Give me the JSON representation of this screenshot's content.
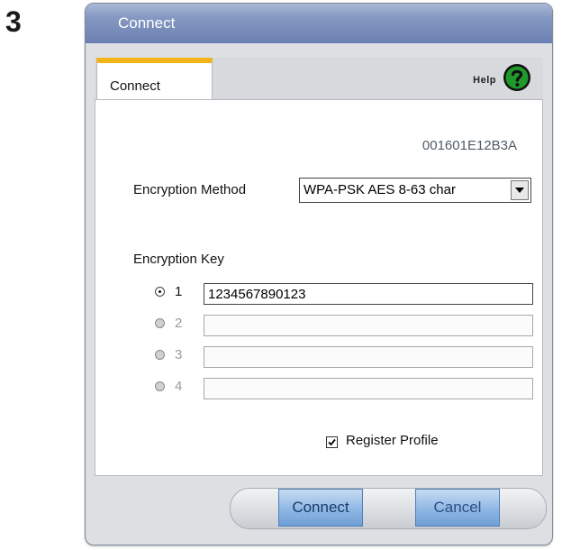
{
  "step": "3",
  "window": {
    "title": "Connect"
  },
  "tabs": [
    {
      "label": "Connect",
      "active": true
    }
  ],
  "help": {
    "label": "Help",
    "icon": "question-icon"
  },
  "mac_address": "001601E12B3A",
  "encryption_method": {
    "label": "Encryption Method",
    "value": "WPA-PSK AES 8-63 char"
  },
  "encryption_key": {
    "label": "Encryption Key",
    "rows": [
      {
        "number": "1",
        "value": "1234567890123",
        "selected": true,
        "enabled": true
      },
      {
        "number": "2",
        "value": "",
        "selected": false,
        "enabled": false
      },
      {
        "number": "3",
        "value": "",
        "selected": false,
        "enabled": false
      },
      {
        "number": "4",
        "value": "",
        "selected": false,
        "enabled": false
      }
    ]
  },
  "register_profile": {
    "label": "Register Profile",
    "checked": true
  },
  "buttons": {
    "connect": "Connect",
    "cancel": "Cancel"
  },
  "colors": {
    "title_bar": "#7d91bf",
    "tab_accent": "#f2b316",
    "button": "#8eb7e3",
    "help_icon": "#1f9a2a"
  }
}
